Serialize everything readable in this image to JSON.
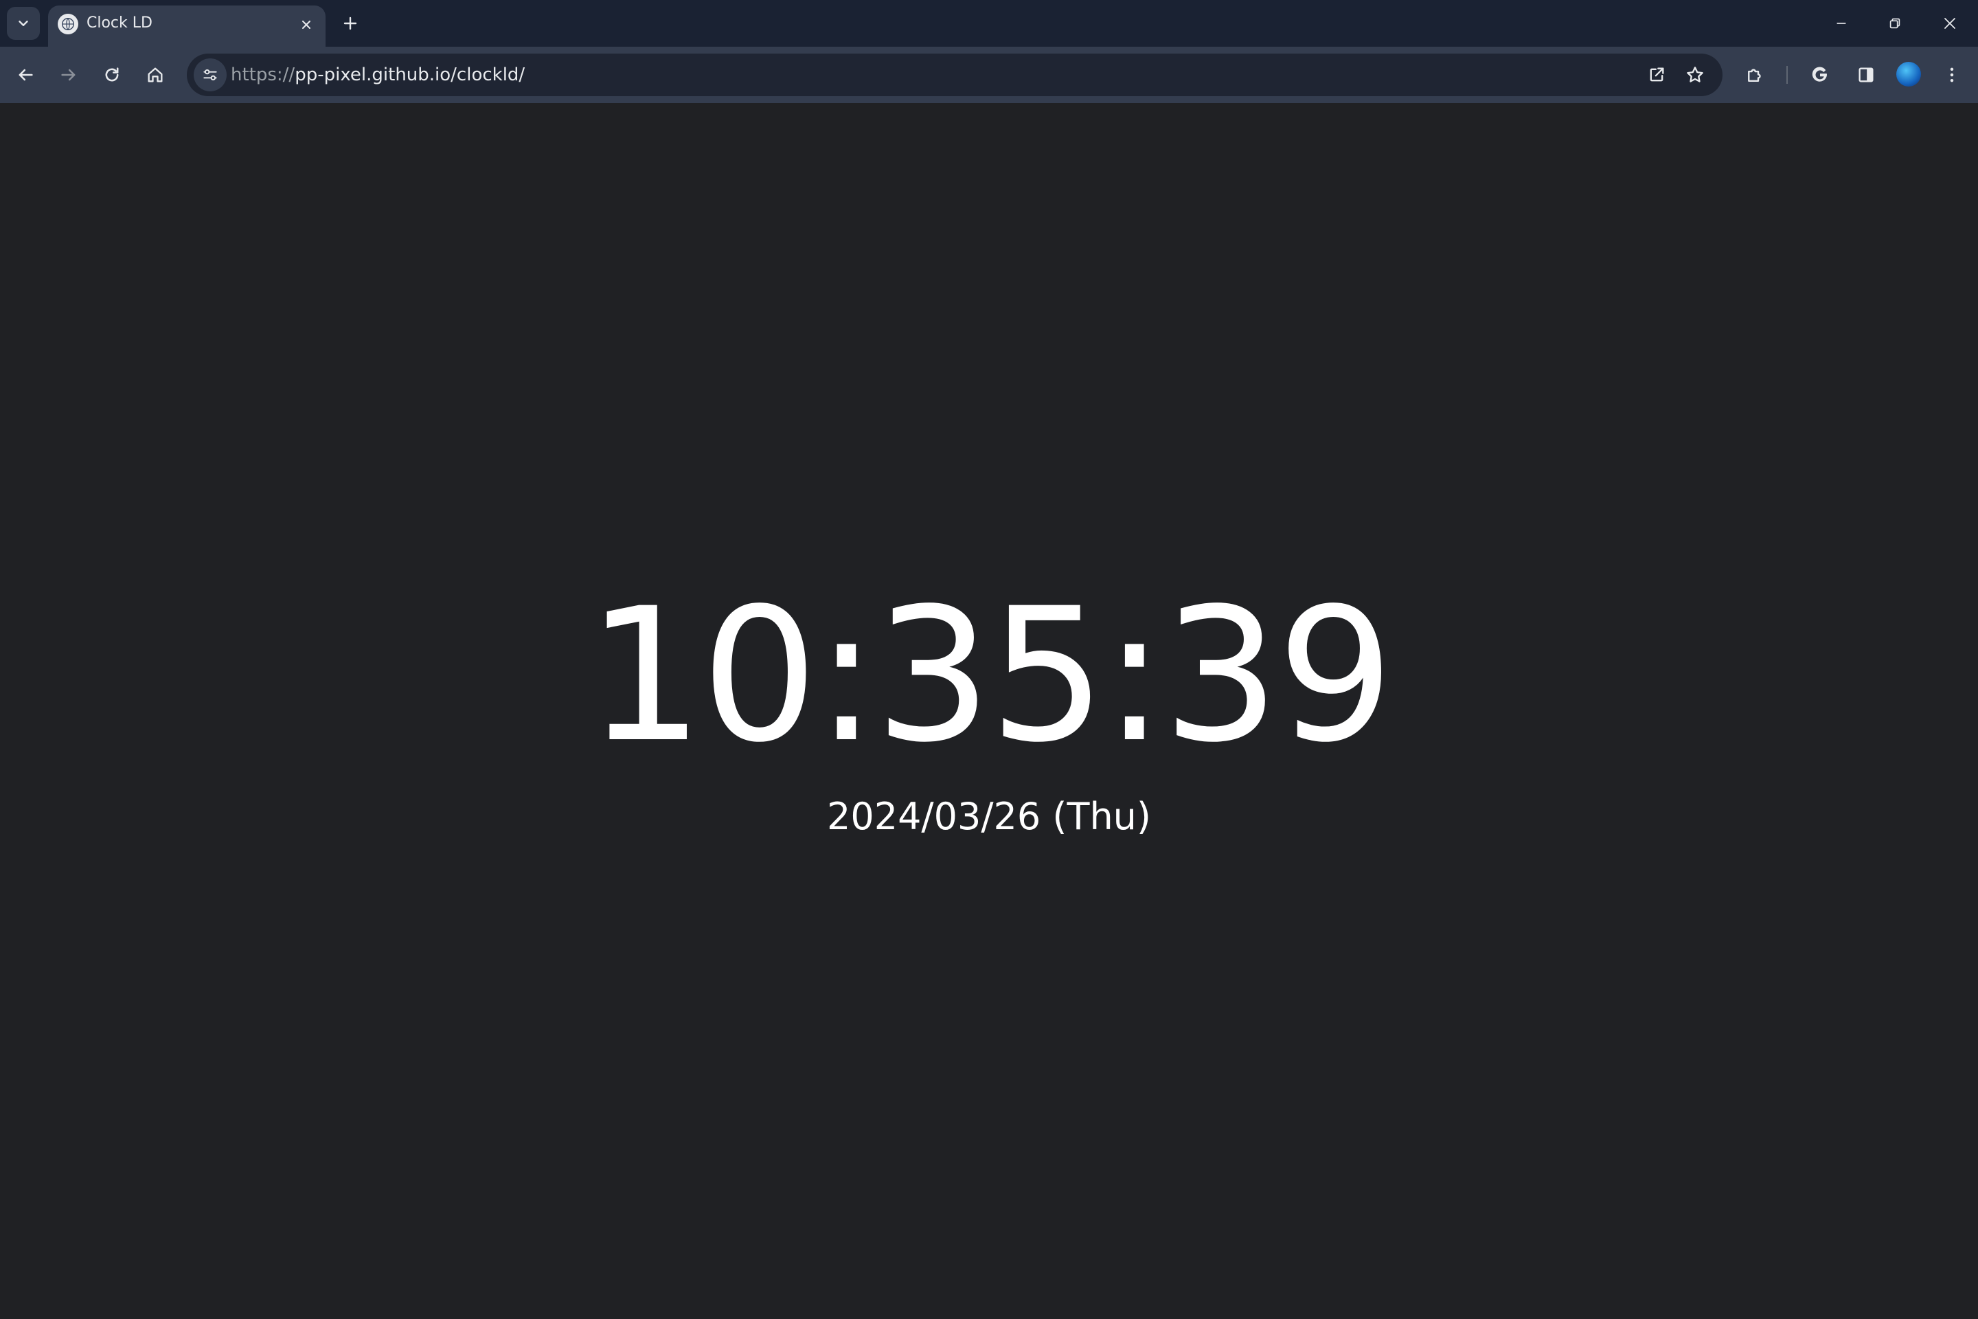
{
  "browser": {
    "tab": {
      "title": "Clock LD"
    },
    "omnibox": {
      "url_scheme": "https://",
      "url_rest": "pp-pixel.github.io/clockld/"
    },
    "icons": {
      "tab_search": "chevron-down-icon",
      "tab_favicon": "globe-icon",
      "tab_close": "close-icon",
      "new_tab": "plus-icon",
      "minimize": "minimize-icon",
      "restore": "restore-icon",
      "close_window": "close-icon",
      "back": "arrow-left-icon",
      "forward": "arrow-right-icon",
      "reload": "reload-icon",
      "home": "home-icon",
      "site_info": "tune-icon",
      "open_in_new": "open-in-new-icon",
      "bookmark": "star-icon",
      "extensions": "puzzle-icon",
      "google": "google-icon",
      "side_panel": "side-panel-icon",
      "menu": "more-vert-icon"
    },
    "colors": {
      "tabstrip": "#1a2233",
      "toolbar": "#343d4f",
      "omnibox": "#1f2533",
      "page_background": "#202124",
      "text": "#ffffff"
    }
  },
  "clock": {
    "time": "10:35:39",
    "date": "2024/03/26 (Thu)"
  }
}
